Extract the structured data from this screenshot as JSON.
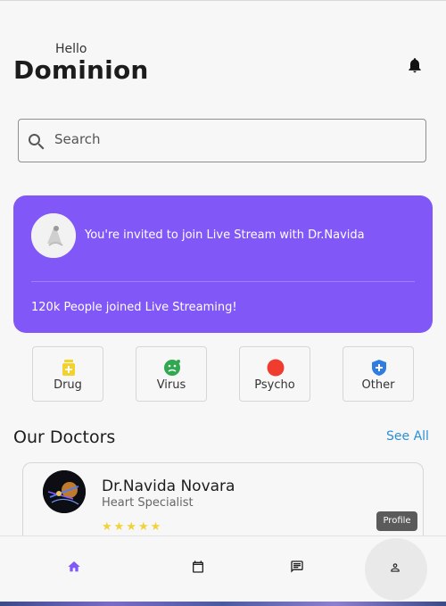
{
  "header": {
    "greeting": "Hello",
    "user_name": "Dominion"
  },
  "search": {
    "placeholder": "Search",
    "value": ""
  },
  "banner": {
    "invite_text": "You're invited to join Live Stream with Dr.Navida",
    "joined_text": "120k People joined Live Streaming!",
    "color": "#8257f7"
  },
  "categories": [
    {
      "label": "Drug",
      "icon": "medicine-icon",
      "color": "#f2d22b"
    },
    {
      "label": "Virus",
      "icon": "virus-icon",
      "color": "#2fa84f"
    },
    {
      "label": "Psycho",
      "icon": "psycho-icon",
      "color": "#f03c2e"
    },
    {
      "label": "Other",
      "icon": "shield-plus-icon",
      "color": "#2f7de1"
    }
  ],
  "doctors": {
    "title": "Our Doctors",
    "see_all": "See All",
    "items": [
      {
        "name": "Dr.Navida Novara",
        "specialty": "Heart Specialist",
        "rating": 5,
        "profile_label": "Profile"
      }
    ]
  },
  "nav": {
    "items": [
      "home-icon",
      "calendar-icon",
      "chat-icon",
      "person-icon"
    ],
    "active": "person-icon",
    "active_color": "#8257f7"
  }
}
